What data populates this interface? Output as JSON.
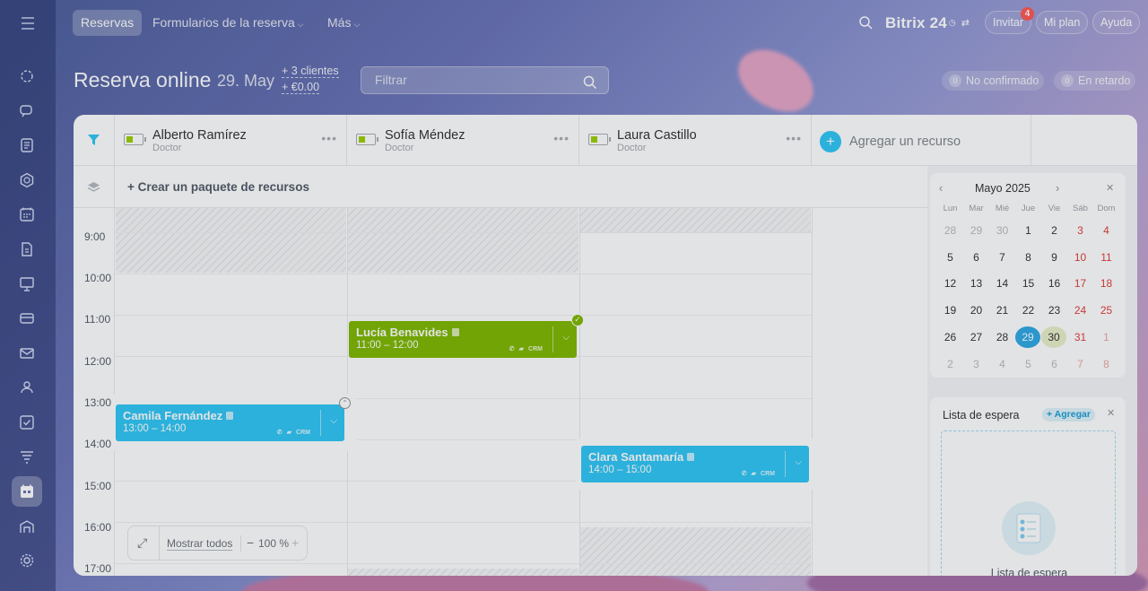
{
  "topbar": {
    "tabs": [
      {
        "label": "Reservas"
      },
      {
        "label": "Formularios de la reserva"
      },
      {
        "label": "Más"
      }
    ],
    "logo": "Bitrix 24",
    "invite": "Invitar",
    "invite_badge": "4",
    "my_plan": "Mi plan",
    "help": "Ayuda"
  },
  "header": {
    "title": "Reserva online",
    "date": "29. May",
    "clients": "+ 3 clientes",
    "amount": "+ €0.00",
    "filter_placeholder": "Filtrar",
    "unconfirmed": {
      "count": "0",
      "label": "No confirmado"
    },
    "late": {
      "count": "0",
      "label": "En retardo"
    }
  },
  "resources": [
    {
      "name": "Alberto Ramírez",
      "role": "Doctor"
    },
    {
      "name": "Sofía Méndez",
      "role": "Doctor"
    },
    {
      "name": "Laura Castillo",
      "role": "Doctor"
    }
  ],
  "add_resource": "Agregar un recurso",
  "create_package": "+ Crear un paquete de recursos",
  "times": [
    "9:00",
    "10:00",
    "11:00",
    "12:00",
    "13:00",
    "14:00",
    "15:00",
    "16:00",
    "17:00"
  ],
  "events": [
    {
      "name": "Lucía Benavides",
      "time": "11:00 – 12:00",
      "crm": "CRM",
      "color": "#7fb800"
    },
    {
      "name": "Camila Fernández",
      "time": "13:00 – 14:00",
      "crm": "CRM",
      "color": "#2fc6f6"
    },
    {
      "name": "Clara Santamaría",
      "time": "14:00 – 15:00",
      "crm": "CRM",
      "color": "#2fc6f6"
    }
  ],
  "zoom": {
    "show_all": "Mostrar todos",
    "level": "100 %"
  },
  "calendar": {
    "month": "Mayo 2025",
    "weekdays": [
      "Lun",
      "Mar",
      "Mié",
      "Jue",
      "Vie",
      "Sáb",
      "Dom"
    ],
    "weeks": [
      [
        "28",
        "29",
        "30",
        "1",
        "2",
        "3",
        "4"
      ],
      [
        "5",
        "6",
        "7",
        "8",
        "9",
        "10",
        "11"
      ],
      [
        "12",
        "13",
        "14",
        "15",
        "16",
        "17",
        "18"
      ],
      [
        "19",
        "20",
        "21",
        "22",
        "23",
        "24",
        "25"
      ],
      [
        "26",
        "27",
        "28",
        "29",
        "30",
        "31",
        "1"
      ],
      [
        "2",
        "3",
        "4",
        "5",
        "6",
        "7",
        "8"
      ]
    ],
    "today": "29",
    "selected": "30"
  },
  "waitlist": {
    "title": "Lista de espera",
    "add": "+ Agregar",
    "empty": "Lista de espera"
  },
  "colors": {
    "accent": "#2fc6f6",
    "green": "#7fb800",
    "weekend": "#e0403e"
  }
}
